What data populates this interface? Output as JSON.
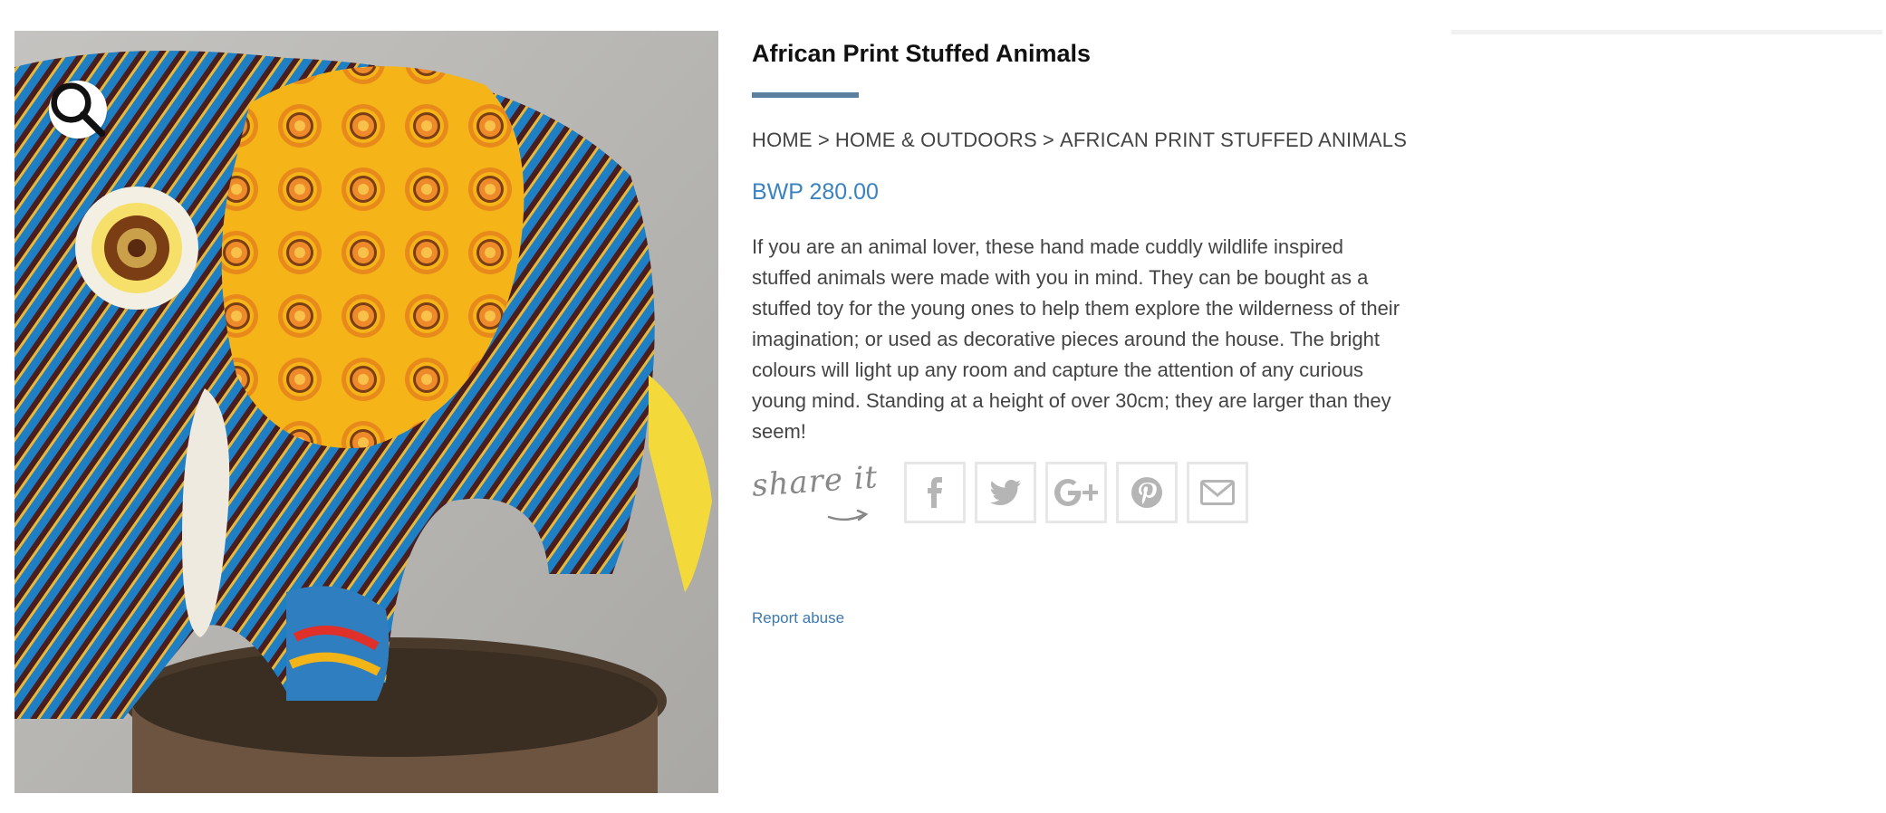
{
  "product": {
    "title": "African Print Stuffed Animals",
    "price": "BWP 280.00",
    "description": "If you are an animal lover, these hand made cuddly wildlife inspired stuffed animals were made with you in mind. They can be bought as a stuffed toy for the young ones to help them explore the wilderness of their imagination; or used as decorative pieces around the house. The bright colours will light up any room and capture the attention of any curious young mind. Standing at a height of over 30cm; they are larger than they seem!",
    "image_icon": "elephant-photo"
  },
  "breadcrumb": {
    "items": [
      "HOME",
      "HOME & OUTDOORS",
      "AFRICAN PRINT STUFFED ANIMALS"
    ],
    "separator": ">"
  },
  "share": {
    "label": "share it",
    "buttons": [
      {
        "name": "facebook",
        "icon": "facebook-icon"
      },
      {
        "name": "twitter",
        "icon": "twitter-icon"
      },
      {
        "name": "google-plus",
        "icon": "google-plus-icon"
      },
      {
        "name": "pinterest",
        "icon": "pinterest-icon"
      },
      {
        "name": "email",
        "icon": "envelope-icon"
      }
    ]
  },
  "zoom": {
    "icon": "search-icon"
  },
  "report_link": "Report abuse",
  "colors": {
    "accent": "#3a82c2",
    "underline": "#5b7f9e",
    "link": "#3d79ad"
  }
}
